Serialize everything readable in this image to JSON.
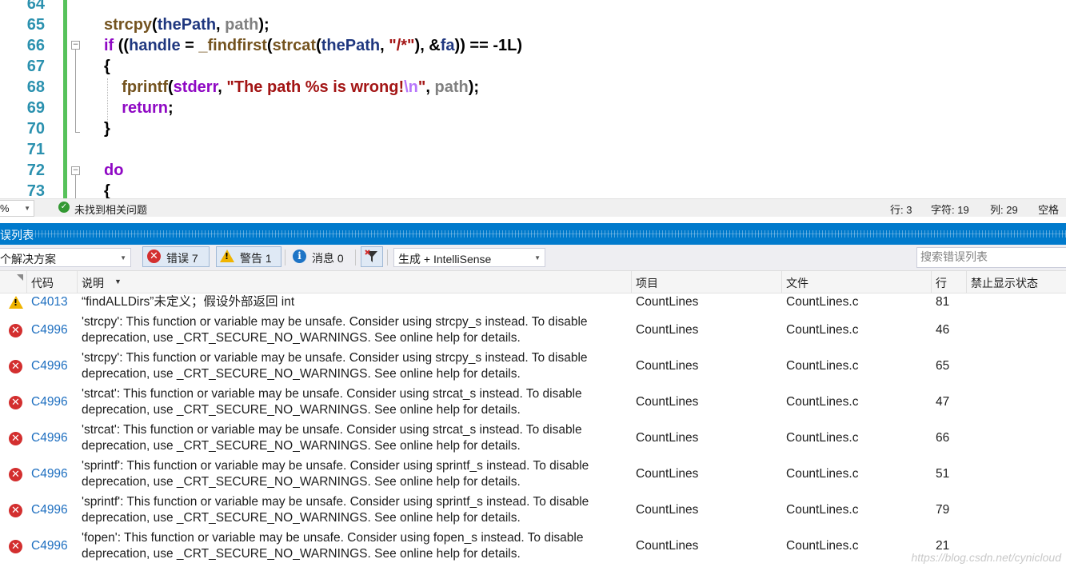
{
  "editor": {
    "lines": [
      {
        "num": "64",
        "tokens": []
      },
      {
        "num": "65",
        "tokens": [
          {
            "t": "strcpy",
            "c": "fn"
          },
          {
            "t": "(",
            "c": "plain"
          },
          {
            "t": "thePath",
            "c": "var"
          },
          {
            "t": ", ",
            "c": "plain"
          },
          {
            "t": "path",
            "c": "param"
          },
          {
            "t": ");",
            "c": "plain"
          }
        ]
      },
      {
        "num": "66",
        "tokens": [
          {
            "t": "if",
            "c": "kw"
          },
          {
            "t": " ((",
            "c": "plain"
          },
          {
            "t": "handle",
            "c": "var"
          },
          {
            "t": " = ",
            "c": "plain"
          },
          {
            "t": "_findfirst",
            "c": "fn"
          },
          {
            "t": "(",
            "c": "plain"
          },
          {
            "t": "strcat",
            "c": "fn"
          },
          {
            "t": "(",
            "c": "plain"
          },
          {
            "t": "thePath",
            "c": "var"
          },
          {
            "t": ", ",
            "c": "plain"
          },
          {
            "t": "\"/*\"",
            "c": "str"
          },
          {
            "t": "), &",
            "c": "plain"
          },
          {
            "t": "fa",
            "c": "var"
          },
          {
            "t": ")) == -1L)",
            "c": "plain"
          }
        ]
      },
      {
        "num": "67",
        "tokens": [
          {
            "t": "{",
            "c": "plain"
          }
        ]
      },
      {
        "num": "68",
        "tokens": [
          {
            "t": "    ",
            "c": "plain"
          },
          {
            "t": "fprintf",
            "c": "fn"
          },
          {
            "t": "(",
            "c": "plain"
          },
          {
            "t": "stderr",
            "c": "kw"
          },
          {
            "t": ", ",
            "c": "plain"
          },
          {
            "t": "\"The path %s is wrong!",
            "c": "str"
          },
          {
            "t": "\\n",
            "c": "esc"
          },
          {
            "t": "\"",
            "c": "str"
          },
          {
            "t": ", ",
            "c": "plain"
          },
          {
            "t": "path",
            "c": "param"
          },
          {
            "t": ");",
            "c": "plain"
          }
        ]
      },
      {
        "num": "69",
        "tokens": [
          {
            "t": "    ",
            "c": "plain"
          },
          {
            "t": "return",
            "c": "kw"
          },
          {
            "t": ";",
            "c": "plain"
          }
        ]
      },
      {
        "num": "70",
        "tokens": [
          {
            "t": "}",
            "c": "plain"
          }
        ]
      },
      {
        "num": "71",
        "tokens": []
      },
      {
        "num": "72",
        "tokens": [
          {
            "t": "do",
            "c": "kw"
          }
        ]
      },
      {
        "num": "73",
        "tokens": [
          {
            "t": "{",
            "c": "plain"
          }
        ]
      }
    ]
  },
  "status": {
    "zoom": "%",
    "issues": "未找到相关问题",
    "row": "行: 3",
    "char": "字符: 19",
    "col": "列: 29",
    "space": "空格"
  },
  "panel": {
    "title": "误列表"
  },
  "toolbar": {
    "scope": "个解决方案",
    "errors": "错误 7",
    "warnings": "警告 1",
    "messages": "消息 0",
    "build_filter": "生成 + IntelliSense",
    "search_placeholder": "搜索错误列表"
  },
  "columns": {
    "code": "代码",
    "desc": "说明",
    "project": "项目",
    "file": "文件",
    "line": "行",
    "suppress": "禁止显示状态"
  },
  "rows": [
    {
      "type": "warning",
      "code": "C4013",
      "desc1": "“findALLDirs”未定义；假设外部返回 int",
      "desc2": "",
      "project": "CountLines",
      "file": "CountLines.c",
      "line": "81"
    },
    {
      "type": "error",
      "code": "C4996",
      "desc1": "'strcpy': This function or variable may be unsafe. Consider using strcpy_s instead. To disable",
      "desc2": "deprecation, use _CRT_SECURE_NO_WARNINGS. See online help for details.",
      "project": "CountLines",
      "file": "CountLines.c",
      "line": "46"
    },
    {
      "type": "error",
      "code": "C4996",
      "desc1": "'strcpy': This function or variable may be unsafe. Consider using strcpy_s instead. To disable",
      "desc2": "deprecation, use _CRT_SECURE_NO_WARNINGS. See online help for details.",
      "project": "CountLines",
      "file": "CountLines.c",
      "line": "65"
    },
    {
      "type": "error",
      "code": "C4996",
      "desc1": "'strcat': This function or variable may be unsafe. Consider using strcat_s instead. To disable",
      "desc2": "deprecation, use _CRT_SECURE_NO_WARNINGS. See online help for details.",
      "project": "CountLines",
      "file": "CountLines.c",
      "line": "47"
    },
    {
      "type": "error",
      "code": "C4996",
      "desc1": "'strcat': This function or variable may be unsafe. Consider using strcat_s instead. To disable",
      "desc2": "deprecation, use _CRT_SECURE_NO_WARNINGS. See online help for details.",
      "project": "CountLines",
      "file": "CountLines.c",
      "line": "66"
    },
    {
      "type": "error",
      "code": "C4996",
      "desc1": "'sprintf': This function or variable may be unsafe. Consider using sprintf_s instead. To disable",
      "desc2": "deprecation, use _CRT_SECURE_NO_WARNINGS. See online help for details.",
      "project": "CountLines",
      "file": "CountLines.c",
      "line": "51"
    },
    {
      "type": "error",
      "code": "C4996",
      "desc1": "'sprintf': This function or variable may be unsafe. Consider using sprintf_s instead. To disable",
      "desc2": "deprecation, use _CRT_SECURE_NO_WARNINGS. See online help for details.",
      "project": "CountLines",
      "file": "CountLines.c",
      "line": "79"
    },
    {
      "type": "error",
      "code": "C4996",
      "desc1": "'fopen': This function or variable may be unsafe. Consider using fopen_s instead. To disable",
      "desc2": "deprecation, use _CRT_SECURE_NO_WARNINGS. See online help for details.",
      "project": "CountLines",
      "file": "CountLines.c",
      "line": "21"
    }
  ],
  "watermark": "https://blog.csdn.net/cynicloud",
  "colors": {
    "accent": "#007acc",
    "line_numbers": "#2b91af",
    "change_bar": "#57c25b",
    "error_icon": "#d32f2f",
    "warning_icon": "#f0b400",
    "info_icon": "#1e74c6",
    "code_link": "#1e6fc0"
  }
}
